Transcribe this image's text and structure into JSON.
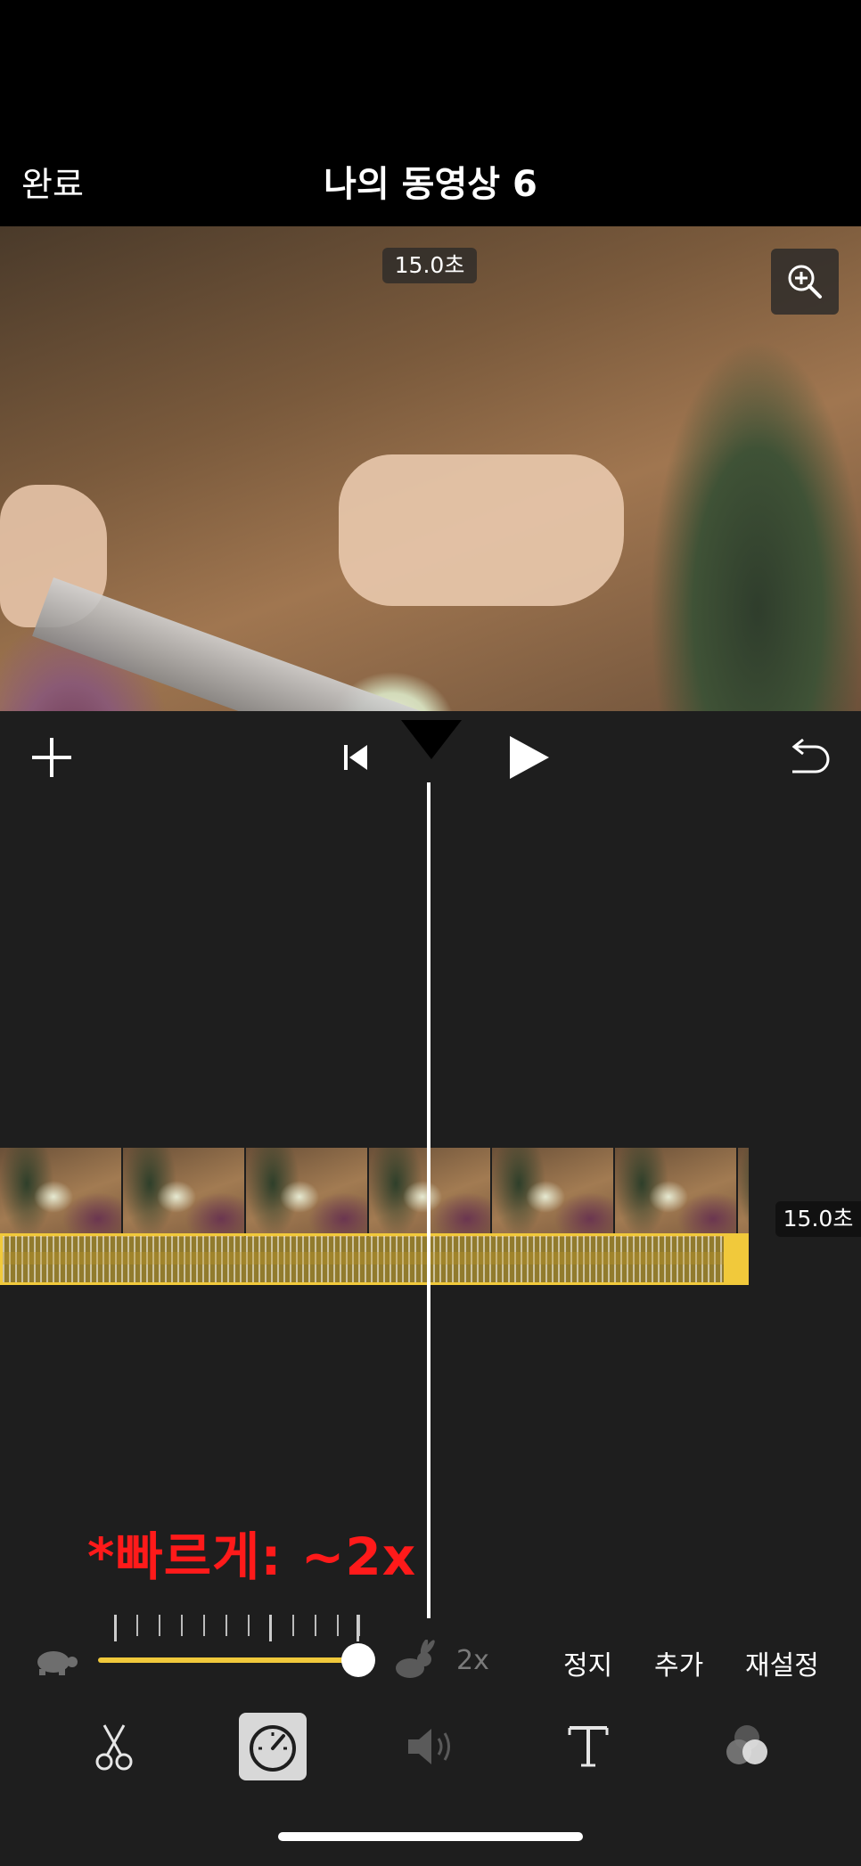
{
  "header": {
    "done_label": "완료",
    "title": "나의 동영상 6"
  },
  "preview": {
    "duration_label": "15.0초",
    "zoom_icon": "zoom-in-icon"
  },
  "transport": {
    "add_icon": "plus-icon",
    "rewind_icon": "skip-to-start-icon",
    "play_icon": "play-icon",
    "undo_icon": "undo-icon"
  },
  "timeline": {
    "clip_duration": "15.0초",
    "annotation": "*빠르게: ~2x"
  },
  "speed": {
    "value_label": "2x",
    "slider_level": 1.0,
    "stop_label": "정지",
    "add_label": "추가",
    "reset_label": "재설정",
    "slow_icon": "turtle-icon",
    "fast_icon": "rabbit-icon"
  },
  "toolbar": {
    "items": [
      "scissors-icon",
      "speedometer-icon",
      "volume-icon",
      "text-icon",
      "filter-icon"
    ],
    "active": "speedometer-icon"
  },
  "colors": {
    "accent": "#f1c93b",
    "annotation": "#ff1a1a",
    "panel": "#1e1e1e"
  }
}
